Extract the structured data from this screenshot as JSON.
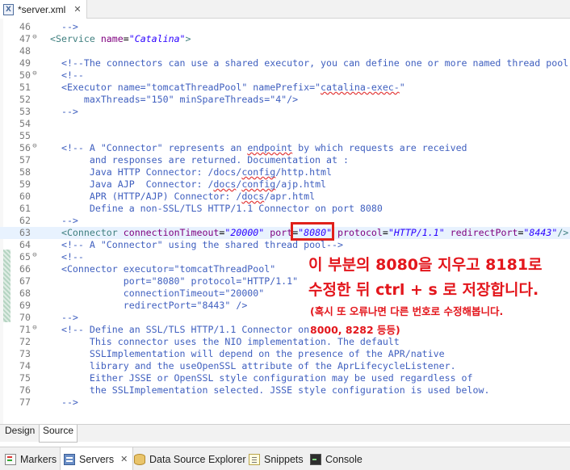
{
  "editor_tab": {
    "title": "*server.xml",
    "close": "✕",
    "icon": "xml-file-icon"
  },
  "lines": [
    {
      "num": "46",
      "fold": "",
      "current": false,
      "segments": [
        {
          "c": "cm",
          "t": "  -->"
        }
      ]
    },
    {
      "num": "47",
      "fold": "⊖",
      "current": false,
      "segments": [
        {
          "c": "tg",
          "t": "<Service "
        },
        {
          "c": "at",
          "t": "name"
        },
        {
          "c": "tx",
          "t": "="
        },
        {
          "c": "vl",
          "t": "\"Catalina\""
        },
        {
          "c": "tg",
          "t": ">"
        }
      ]
    },
    {
      "num": "48",
      "fold": "",
      "current": false,
      "segments": []
    },
    {
      "num": "49",
      "fold": "",
      "current": false,
      "segments": [
        {
          "c": "cm",
          "t": "  <!--The connectors can use a shared executor, you can define one or more named thread pool"
        }
      ]
    },
    {
      "num": "50",
      "fold": "⊖",
      "current": false,
      "segments": [
        {
          "c": "cm",
          "t": "  <!--"
        }
      ]
    },
    {
      "num": "51",
      "fold": "",
      "current": false,
      "segments": [
        {
          "c": "cm",
          "t": "  <Executor name=\"tomcatThreadPool\" namePrefix=\""
        },
        {
          "c": "cm sq",
          "t": "catalina-exec-"
        },
        {
          "c": "cm",
          "t": "\""
        }
      ]
    },
    {
      "num": "52",
      "fold": "",
      "current": false,
      "segments": [
        {
          "c": "cm",
          "t": "      maxThreads=\"150\" minSpareThreads=\"4\"/>"
        }
      ]
    },
    {
      "num": "53",
      "fold": "",
      "current": false,
      "segments": [
        {
          "c": "cm",
          "t": "  -->"
        }
      ]
    },
    {
      "num": "54",
      "fold": "",
      "current": false,
      "segments": []
    },
    {
      "num": "55",
      "fold": "",
      "current": false,
      "segments": []
    },
    {
      "num": "56",
      "fold": "⊖",
      "current": false,
      "segments": [
        {
          "c": "cm",
          "t": "  <!-- A \"Connector\" represents an "
        },
        {
          "c": "cm sq",
          "t": "endpoint"
        },
        {
          "c": "cm",
          "t": " by which requests are received"
        }
      ]
    },
    {
      "num": "57",
      "fold": "",
      "current": false,
      "segments": [
        {
          "c": "cm",
          "t": "       and responses are returned. Documentation at :"
        }
      ]
    },
    {
      "num": "58",
      "fold": "",
      "current": false,
      "segments": [
        {
          "c": "cm",
          "t": "       Java HTTP Connector: /docs/"
        },
        {
          "c": "cm sq",
          "t": "config"
        },
        {
          "c": "cm",
          "t": "/http.html"
        }
      ]
    },
    {
      "num": "59",
      "fold": "",
      "current": false,
      "segments": [
        {
          "c": "cm",
          "t": "       Java AJP  Connector: /"
        },
        {
          "c": "cm sq",
          "t": "docs"
        },
        {
          "c": "cm",
          "t": "/"
        },
        {
          "c": "cm sq",
          "t": "config"
        },
        {
          "c": "cm",
          "t": "/ajp.html"
        }
      ]
    },
    {
      "num": "60",
      "fold": "",
      "current": false,
      "segments": [
        {
          "c": "cm",
          "t": "       APR (HTTP/AJP) Connector: /"
        },
        {
          "c": "cm sq",
          "t": "docs"
        },
        {
          "c": "cm",
          "t": "/apr.html"
        }
      ]
    },
    {
      "num": "61",
      "fold": "",
      "current": false,
      "segments": [
        {
          "c": "cm",
          "t": "       Define a non-SSL/TLS HTTP/1.1 Connector on port 8080"
        }
      ]
    },
    {
      "num": "62",
      "fold": "",
      "current": false,
      "segments": [
        {
          "c": "cm",
          "t": "  -->"
        }
      ]
    },
    {
      "num": "63",
      "fold": "",
      "current": true,
      "segments": [
        {
          "c": "tg",
          "t": "  <Connector "
        },
        {
          "c": "at",
          "t": "connectionTimeout"
        },
        {
          "c": "tx",
          "t": "="
        },
        {
          "c": "vl",
          "t": "\"20000\""
        },
        {
          "c": "tx",
          "t": " "
        },
        {
          "c": "at",
          "t": "port"
        },
        {
          "c": "tx",
          "t": "="
        },
        {
          "c": "vl",
          "t": "\"8080\""
        },
        {
          "c": "tx",
          "t": " "
        },
        {
          "c": "at",
          "t": "protocol"
        },
        {
          "c": "tx",
          "t": "="
        },
        {
          "c": "vl",
          "t": "\"HTTP/1.1\""
        },
        {
          "c": "tx",
          "t": " "
        },
        {
          "c": "at",
          "t": "redirectPort"
        },
        {
          "c": "tx",
          "t": "="
        },
        {
          "c": "vl",
          "t": "\"8443\""
        },
        {
          "c": "tg",
          "t": "/>"
        }
      ]
    },
    {
      "num": "64",
      "fold": "",
      "current": false,
      "segments": [
        {
          "c": "cm",
          "t": "  <!-- A \"Connector\" using the shared thread pool-->"
        }
      ]
    },
    {
      "num": "65",
      "fold": "⊖",
      "current": false,
      "segments": [
        {
          "c": "cm",
          "t": "  <!--"
        }
      ]
    },
    {
      "num": "66",
      "fold": "",
      "current": false,
      "segments": [
        {
          "c": "cm",
          "t": "  <Connector executor=\"tomcatThreadPool\""
        }
      ]
    },
    {
      "num": "67",
      "fold": "",
      "current": false,
      "segments": [
        {
          "c": "cm",
          "t": "             port=\"8080\" protocol=\"HTTP/1.1\""
        }
      ]
    },
    {
      "num": "68",
      "fold": "",
      "current": false,
      "segments": [
        {
          "c": "cm",
          "t": "             connectionTimeout=\"20000\""
        }
      ]
    },
    {
      "num": "69",
      "fold": "",
      "current": false,
      "segments": [
        {
          "c": "cm",
          "t": "             redirectPort=\"8443\" />"
        }
      ]
    },
    {
      "num": "70",
      "fold": "",
      "current": false,
      "segments": [
        {
          "c": "cm",
          "t": "  -->"
        }
      ]
    },
    {
      "num": "71",
      "fold": "⊖",
      "current": false,
      "segments": [
        {
          "c": "cm",
          "t": "  <!-- Define an SSL/TLS HTTP/1.1 Connector on"
        }
      ]
    },
    {
      "num": "72",
      "fold": "",
      "current": false,
      "segments": [
        {
          "c": "cm",
          "t": "       This connector uses the NIO implementation. The default"
        }
      ]
    },
    {
      "num": "73",
      "fold": "",
      "current": false,
      "segments": [
        {
          "c": "cm",
          "t": "       SSLImplementation will depend on the presence of the APR/native"
        }
      ]
    },
    {
      "num": "74",
      "fold": "",
      "current": false,
      "segments": [
        {
          "c": "cm",
          "t": "       library and the useOpenSSL attribute of the AprLifecycleListener."
        }
      ]
    },
    {
      "num": "75",
      "fold": "",
      "current": false,
      "segments": [
        {
          "c": "cm",
          "t": "       Either JSSE or OpenSSL style configuration may be used regardless of"
        }
      ]
    },
    {
      "num": "76",
      "fold": "",
      "current": false,
      "segments": [
        {
          "c": "cm",
          "t": "       the SSLImplementation selected. JSSE style configuration is used below."
        }
      ]
    },
    {
      "num": "77",
      "fold": "",
      "current": false,
      "segments": [
        {
          "c": "cm",
          "t": "  -->"
        }
      ]
    }
  ],
  "annotation": {
    "line1": "이 부분의 8080을 지우고 8181로",
    "line2": "수정한 뒤 ctrl + s 로 저장합니다.",
    "line3": "(혹시 또 오류나면 다른 번호로 수정해봅니다.",
    "line4": "8000, 8282 등등)",
    "color": "#e3161c"
  },
  "editor_mode_tabs": {
    "design": "Design",
    "source": "Source",
    "active": "Source"
  },
  "view_tabs": [
    {
      "label": "Markers",
      "icon": "markers-icon"
    },
    {
      "label": "Servers",
      "icon": "servers-icon",
      "close": "✕"
    },
    {
      "label": "Data Source Explorer",
      "icon": "data-source-explorer-icon"
    },
    {
      "label": "Snippets",
      "icon": "snippets-icon"
    },
    {
      "label": "Console",
      "icon": "console-icon"
    }
  ]
}
